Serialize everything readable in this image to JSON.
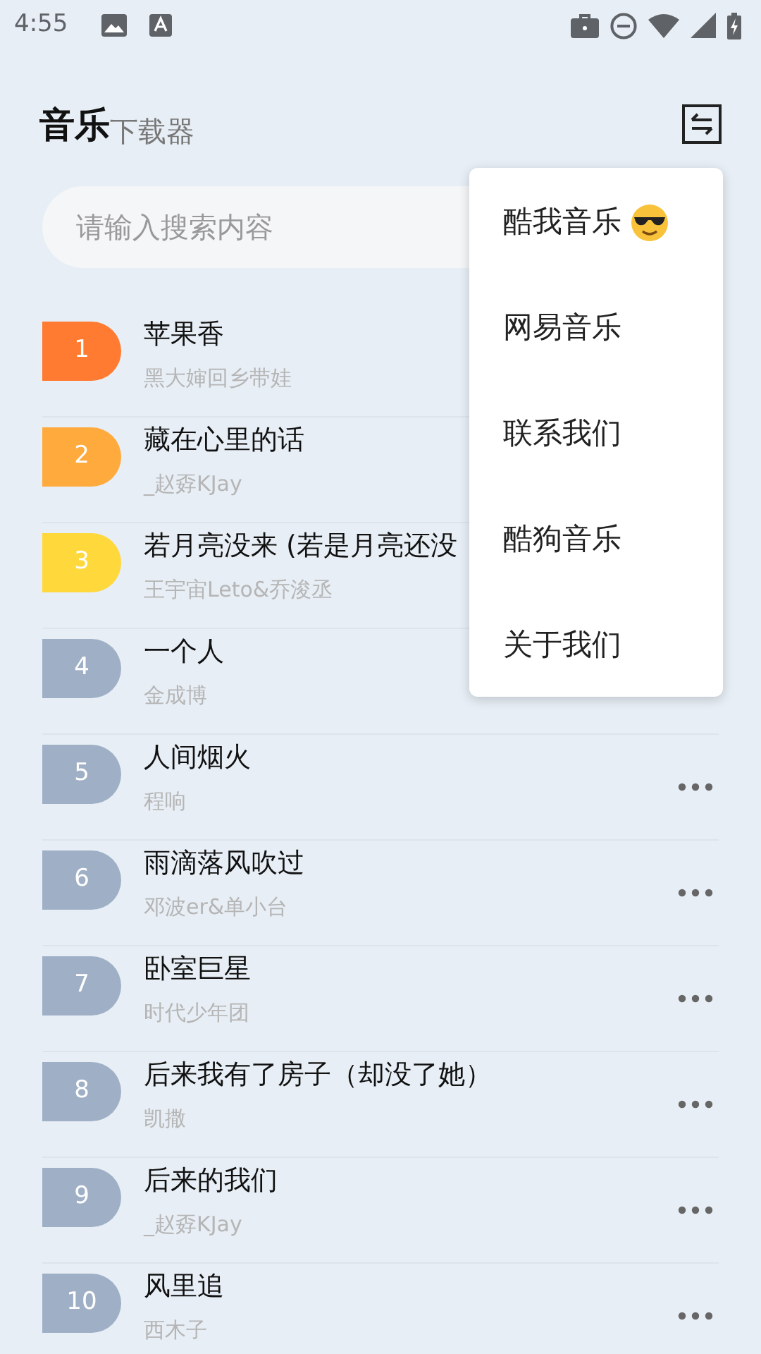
{
  "status_bar": {
    "time": "4:55"
  },
  "header": {
    "title": "音乐",
    "subtitle": "下载器"
  },
  "search": {
    "placeholder": "请输入搜索内容"
  },
  "songs": [
    {
      "rank": "1",
      "title": "苹果香",
      "artist": "黑大婶回乡带娃",
      "color": "#ff7b32"
    },
    {
      "rank": "2",
      "title": "藏在心里的话",
      "artist": "_赵孬KJay",
      "color": "#ffaa3c"
    },
    {
      "rank": "3",
      "title": "若月亮没来 (若是月亮还没",
      "artist": "王宇宙Leto&乔浚丞",
      "color": "#ffd83c"
    },
    {
      "rank": "4",
      "title": "一个人",
      "artist": "金成博",
      "color": "#9fb0c6"
    },
    {
      "rank": "5",
      "title": "人间烟火",
      "artist": "程响",
      "color": "#9fb0c6",
      "has_more": true
    },
    {
      "rank": "6",
      "title": "雨滴落风吹过",
      "artist": "邓波er&单小台",
      "color": "#9fb0c6",
      "has_more": true
    },
    {
      "rank": "7",
      "title": "卧室巨星",
      "artist": "时代少年团",
      "color": "#9fb0c6",
      "has_more": true
    },
    {
      "rank": "8",
      "title": "后来我有了房子（却没了她）",
      "artist": "凯撒",
      "color": "#9fb0c6",
      "has_more": true
    },
    {
      "rank": "9",
      "title": "后来的我们",
      "artist": "_赵孬KJay",
      "color": "#9fb0c6",
      "has_more": true
    },
    {
      "rank": "10",
      "title": "风里追",
      "artist": "西木子",
      "color": "#9fb0c6",
      "has_more": true
    }
  ],
  "menu": [
    {
      "label": "酷我音乐",
      "kind": "emoji"
    },
    {
      "label": "网易音乐",
      "kind": "plain"
    },
    {
      "label": "联系我们",
      "kind": "plain"
    },
    {
      "label": "酷狗音乐",
      "kind": "plain"
    },
    {
      "label": "关于我们",
      "kind": "plain"
    }
  ]
}
